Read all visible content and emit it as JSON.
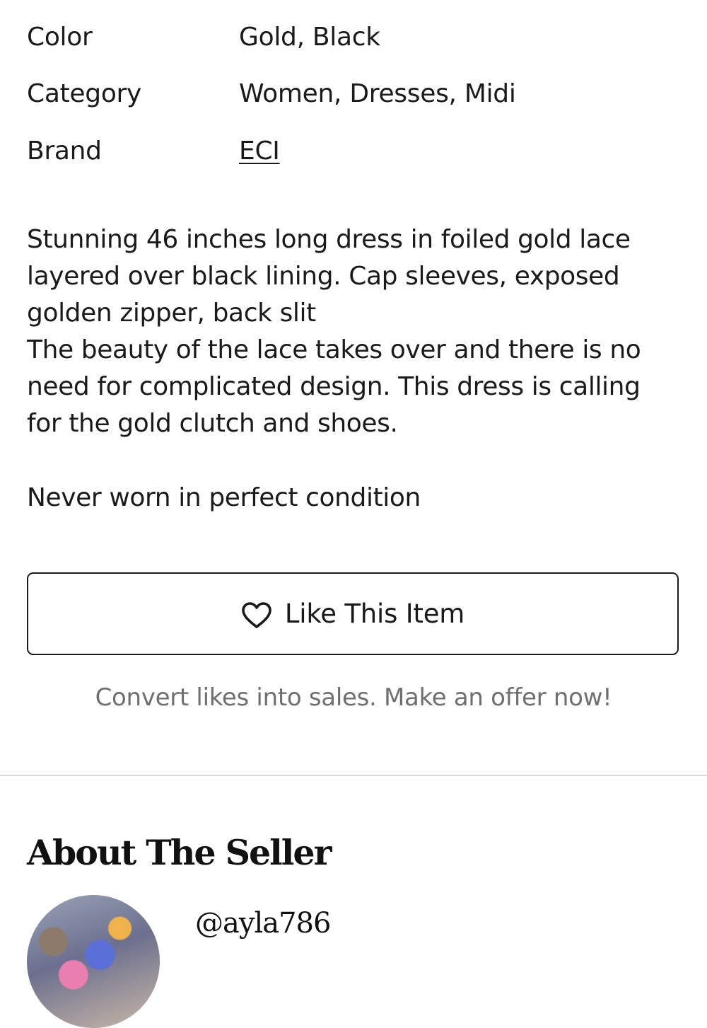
{
  "attributes": [
    {
      "label": "Color",
      "value": "Gold, Black"
    },
    {
      "label": "Category",
      "value": "Women, Dresses, Midi"
    },
    {
      "label": "Brand",
      "value": "ECI"
    }
  ],
  "description": {
    "lines": [
      "Stunning 46 inches long dress in foiled gold lace",
      "layered over black lining. Cap sleeves, exposed",
      "golden zipper, back slit",
      "The beauty of the lace takes over and there is no",
      "need for complicated design. This dress is calling",
      "for the gold clutch and shoes."
    ],
    "condition": "Never worn in perfect condition"
  },
  "like": {
    "button_label": "Like This Item",
    "icon": "heart-outline-icon",
    "hint": "Convert likes into sales. Make an offer now!"
  },
  "seller": {
    "section_title": "About The Seller",
    "handle": "@ayla786"
  }
}
